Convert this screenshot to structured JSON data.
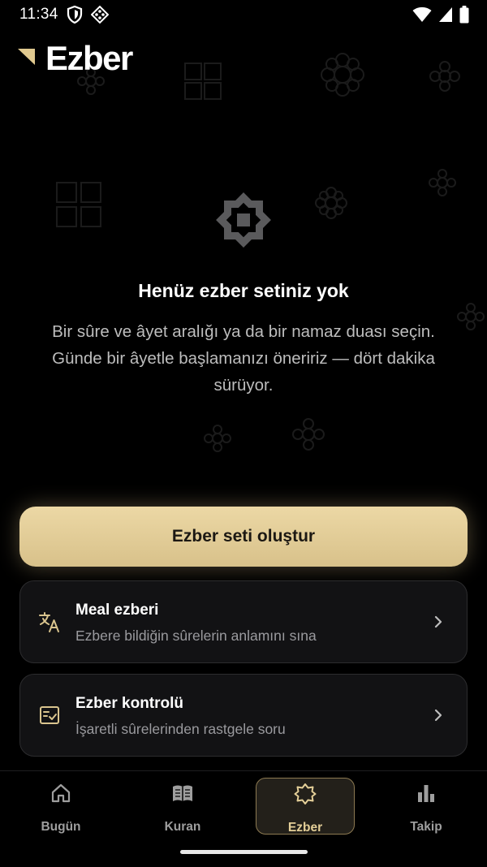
{
  "status_bar": {
    "time": "11:34",
    "left_icons": [
      "shield-icon",
      "network-icon"
    ],
    "right_icons": [
      "wifi-icon",
      "cell-signal-icon",
      "battery-icon"
    ]
  },
  "header": {
    "title": "Ezber",
    "brand_icon": "triangle-flag-icon"
  },
  "empty_state": {
    "icon": "eight-point-star-icon",
    "title": "Henüz ezber setiniz yok",
    "description": "Bir sûre ve âyet aralığı ya da bir namaz duası seçin. Günde bir âyetle başlamanızı öneririz — dört dakika sürüyor."
  },
  "primary_action": {
    "label": "Ezber seti oluştur"
  },
  "options": [
    {
      "title": "Meal ezberi",
      "subtitle": "Ezbere bildiğin sûrelerin anlamını sına",
      "icon": "translate-icon"
    },
    {
      "title": "Ezber kontrolü",
      "subtitle": "İşaretli sûrelerinden rastgele soru",
      "icon": "checklist-icon"
    }
  ],
  "bottom_nav": {
    "items": [
      {
        "label": "Bugün",
        "icon": "home-icon",
        "active": false
      },
      {
        "label": "Kuran",
        "icon": "book-icon",
        "active": false
      },
      {
        "label": "Ezber",
        "icon": "star-icon",
        "active": true
      },
      {
        "label": "Takip",
        "icon": "bar-chart-icon",
        "active": false
      }
    ]
  },
  "colors": {
    "background": "#000000",
    "accent_gold": "#e4cf98",
    "card_background": "#121214",
    "card_border": "#2c2c2e",
    "muted_text": "#9a9a9e"
  }
}
